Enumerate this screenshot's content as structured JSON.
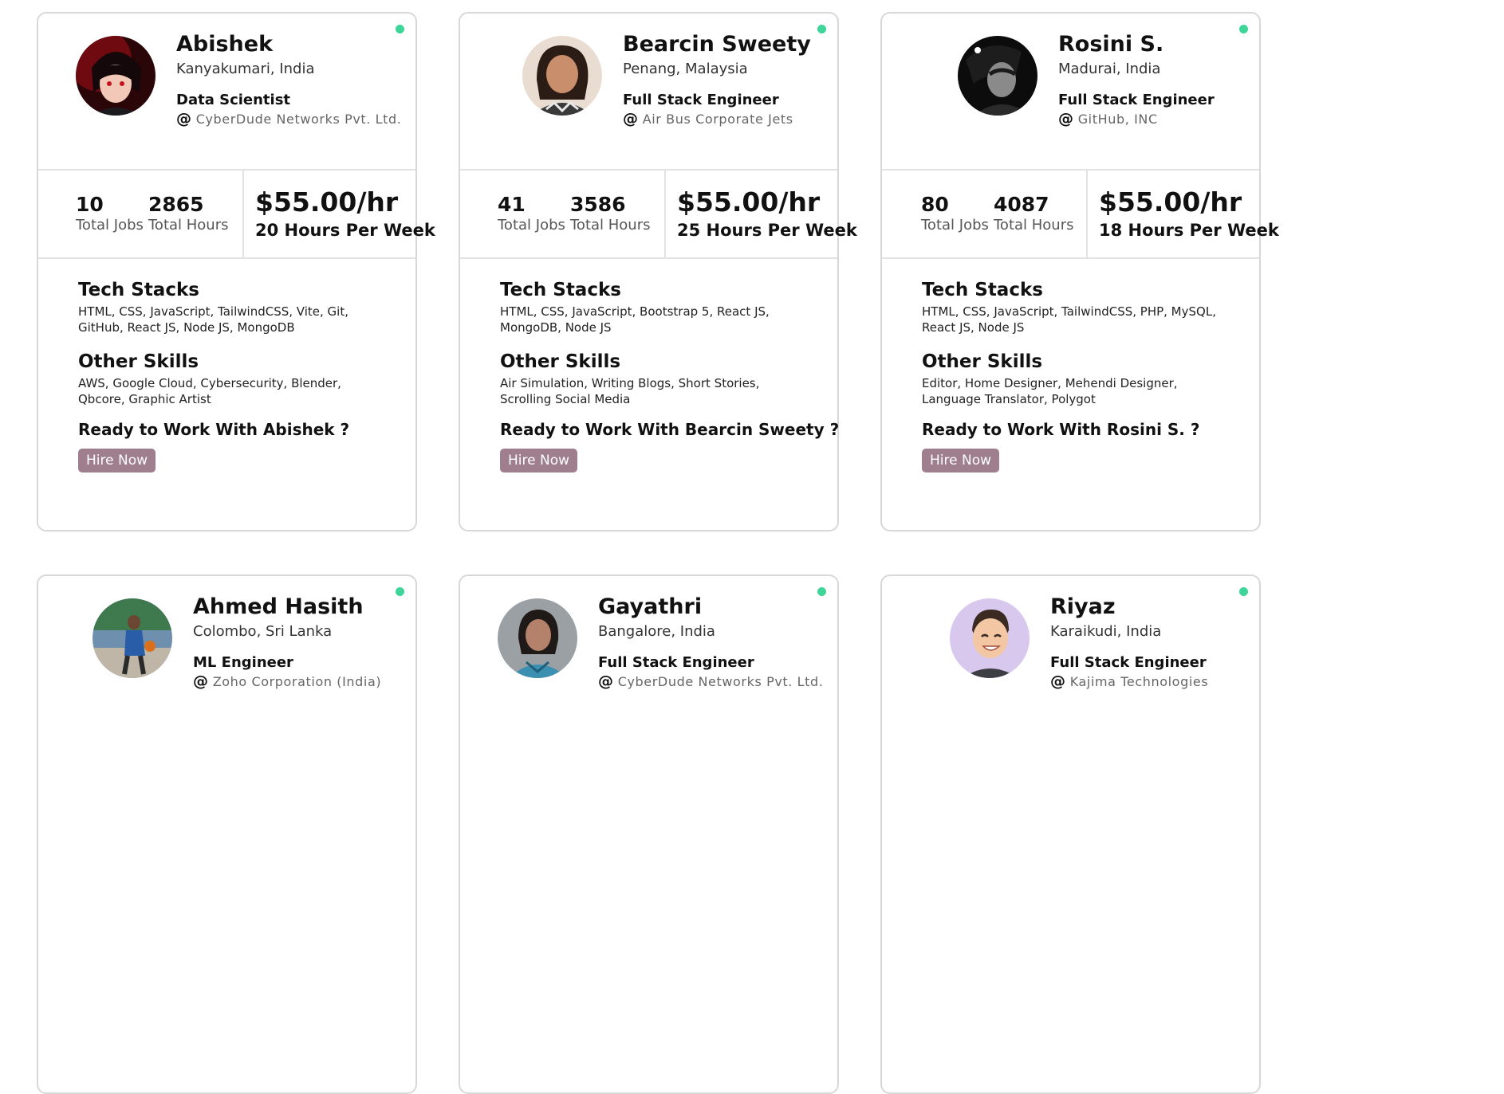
{
  "theme": {
    "online": "#3dd598",
    "hire_button": "#9f7e8d",
    "border": "#d8d8d8"
  },
  "labels": {
    "total_jobs": "Total Jobs",
    "total_hours": "Total Hours",
    "tech_stacks": "Tech Stacks",
    "other_skills": "Other Skills",
    "hire": "Hire Now",
    "at": "@"
  },
  "profiles": [
    {
      "name": "Abishek",
      "location": "Kanyakumari, India",
      "role": "Data Scientist",
      "company": "CyberDude Networks Pvt. Ltd.",
      "total_jobs": "10",
      "total_hours": "2865",
      "rate": "$55.00/hr",
      "hours_per_week": "20 Hours Per Week",
      "tech_stacks": "HTML, CSS, JavaScript, TailwindCSS, Vite, Git, GitHub, React JS, Node JS, MongoDB",
      "other_skills": "AWS, Google Cloud, Cybersecurity, Blender, Qbcore, Graphic Artist",
      "ready": "Ready to Work With Abishek ?",
      "avatar_icon": "anime-character-avatar"
    },
    {
      "name": "Bearcin Sweety",
      "location": "Penang, Malaysia",
      "role": "Full Stack Engineer",
      "company": "Air Bus Corporate Jets",
      "total_jobs": "41",
      "total_hours": "3586",
      "rate": "$55.00/hr",
      "hours_per_week": "25 Hours Per Week",
      "tech_stacks": "HTML, CSS, JavaScript, Bootstrap 5, React JS, MongoDB, Node JS",
      "other_skills": "Air Simulation, Writing Blogs, Short Stories, Scrolling Social Media",
      "ready": "Ready to Work With Bearcin Sweety ?",
      "avatar_icon": "person-photo-avatar"
    },
    {
      "name": "Rosini S.",
      "location": "Madurai, India",
      "role": "Full Stack Engineer",
      "company": "GitHub, INC",
      "total_jobs": "80",
      "total_hours": "4087",
      "rate": "$55.00/hr",
      "hours_per_week": "18 Hours Per Week",
      "tech_stacks": "HTML, CSS, JavaScript, TailwindCSS, PHP, MySQL, React JS, Node JS",
      "other_skills": "Editor, Home Designer, Mehendi Designer, Language Translator, Polygot",
      "ready": "Ready to Work With Rosini S. ?",
      "avatar_icon": "monochrome-photo-avatar"
    },
    {
      "name": "Ahmed Hasith",
      "location": "Colombo, Sri Lanka",
      "role": "ML Engineer",
      "company": "Zoho Corporation (India)",
      "avatar_icon": "basketball-photo-avatar"
    },
    {
      "name": "Gayathri",
      "location": "Bangalore, India",
      "role": "Full Stack Engineer",
      "company": "CyberDude Networks Pvt. Ltd.",
      "avatar_icon": "person-photo-avatar"
    },
    {
      "name": "Riyaz",
      "location": "Karaikudi, India",
      "role": "Full Stack Engineer",
      "company": "Kajima Technologies",
      "avatar_icon": "memoji-avatar"
    }
  ]
}
